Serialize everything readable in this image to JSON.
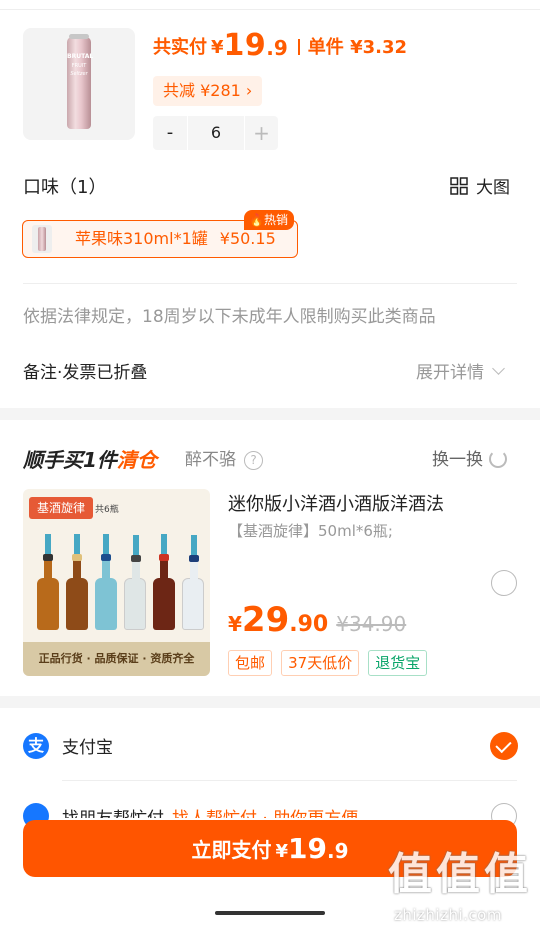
{
  "order": {
    "product_image_text": {
      "brand": "BRUTAL",
      "line": "FRUIT",
      "sub": "Seltzer"
    },
    "pay_label": "共实付",
    "currency": "¥",
    "pay_int": "19",
    "pay_dec": ".9",
    "unit_label": "单件 ¥3.32",
    "reduce_label": "共减 ¥281 ›",
    "qty_minus": "-",
    "qty_value": "6",
    "qty_plus": "+"
  },
  "flavor": {
    "title": "口味（1）",
    "big_view_label": "大图",
    "chip_name": "苹果味310ml*1罐",
    "chip_price": "¥50.15",
    "hot_label": "🔥热销"
  },
  "legal_notice": "依据法律规定，18周岁以下未成年人限制购买此类商品",
  "remark": {
    "label": "备注·发票已折叠",
    "expand_label": "展开详情"
  },
  "addon": {
    "title_prefix": "顺手买1件",
    "title_suffix": "清仓",
    "drunk_label": "醉不骆",
    "help_icon": "?",
    "swap_label": "换一换",
    "image_tag": "基酒旋律",
    "image_tag2": "共6瓶",
    "image_bottom": "正品行货 · 品质保证 · 资质齐全",
    "product_name": "迷你版小洋酒小酒版洋酒法",
    "product_spec": "【基酒旋律】50ml*6瓶;",
    "price_currency": "¥",
    "price_int": "29",
    "price_dec": ".90",
    "price_orig": "¥34.90",
    "badges": [
      "包邮",
      "37天低价",
      "退货宝"
    ]
  },
  "payment": {
    "alipay_icon": "支",
    "alipay_label": "支付宝",
    "peek_label": "找朋友帮忙付",
    "peek_sub": "找人帮忙付 · 助你更方便"
  },
  "paybtn": {
    "label": "立即支付",
    "currency": "¥",
    "int": "19",
    "dec": ".9"
  },
  "watermark": {
    "glyphs": [
      "值",
      "值",
      "值"
    ],
    "url": "zhizhizhi.com"
  },
  "colors": {
    "accent": "#ff5b00",
    "alipay": "#1677ff",
    "green": "#0aa56a"
  }
}
